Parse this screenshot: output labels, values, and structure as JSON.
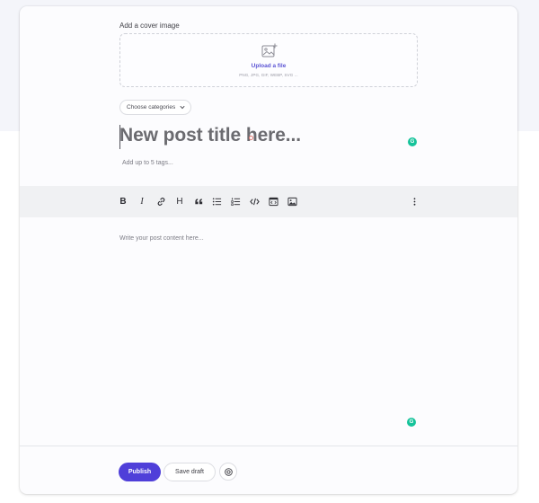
{
  "cover": {
    "label": "Add a cover image",
    "upload_link": "Upload a file",
    "formats": "PNG, JPG, GIF, WEBP, SVG ..."
  },
  "categories": {
    "label": "Choose categories"
  },
  "title": {
    "placeholder": "New post title here..."
  },
  "tags": {
    "placeholder": "Add up to 5 tags..."
  },
  "toolbar": {
    "items": [
      {
        "name": "bold",
        "glyph": "B"
      },
      {
        "name": "italic",
        "glyph": "I"
      },
      {
        "name": "link",
        "glyph": ""
      },
      {
        "name": "heading",
        "glyph": "H"
      },
      {
        "name": "quote",
        "glyph": ""
      },
      {
        "name": "bullet-list",
        "glyph": ""
      },
      {
        "name": "numbered-list",
        "glyph": ""
      },
      {
        "name": "code",
        "glyph": ""
      },
      {
        "name": "code-block",
        "glyph": ""
      },
      {
        "name": "image",
        "glyph": ""
      },
      {
        "name": "more",
        "glyph": ""
      }
    ]
  },
  "body": {
    "placeholder": "Write your post content here..."
  },
  "grammar": {
    "badge": "G",
    "color": "#15c39a"
  },
  "actions": {
    "publish_label": "Publish",
    "draft_label": "Save draft"
  },
  "colors": {
    "accent": "#4f3fd9",
    "link": "#5b54d4"
  }
}
